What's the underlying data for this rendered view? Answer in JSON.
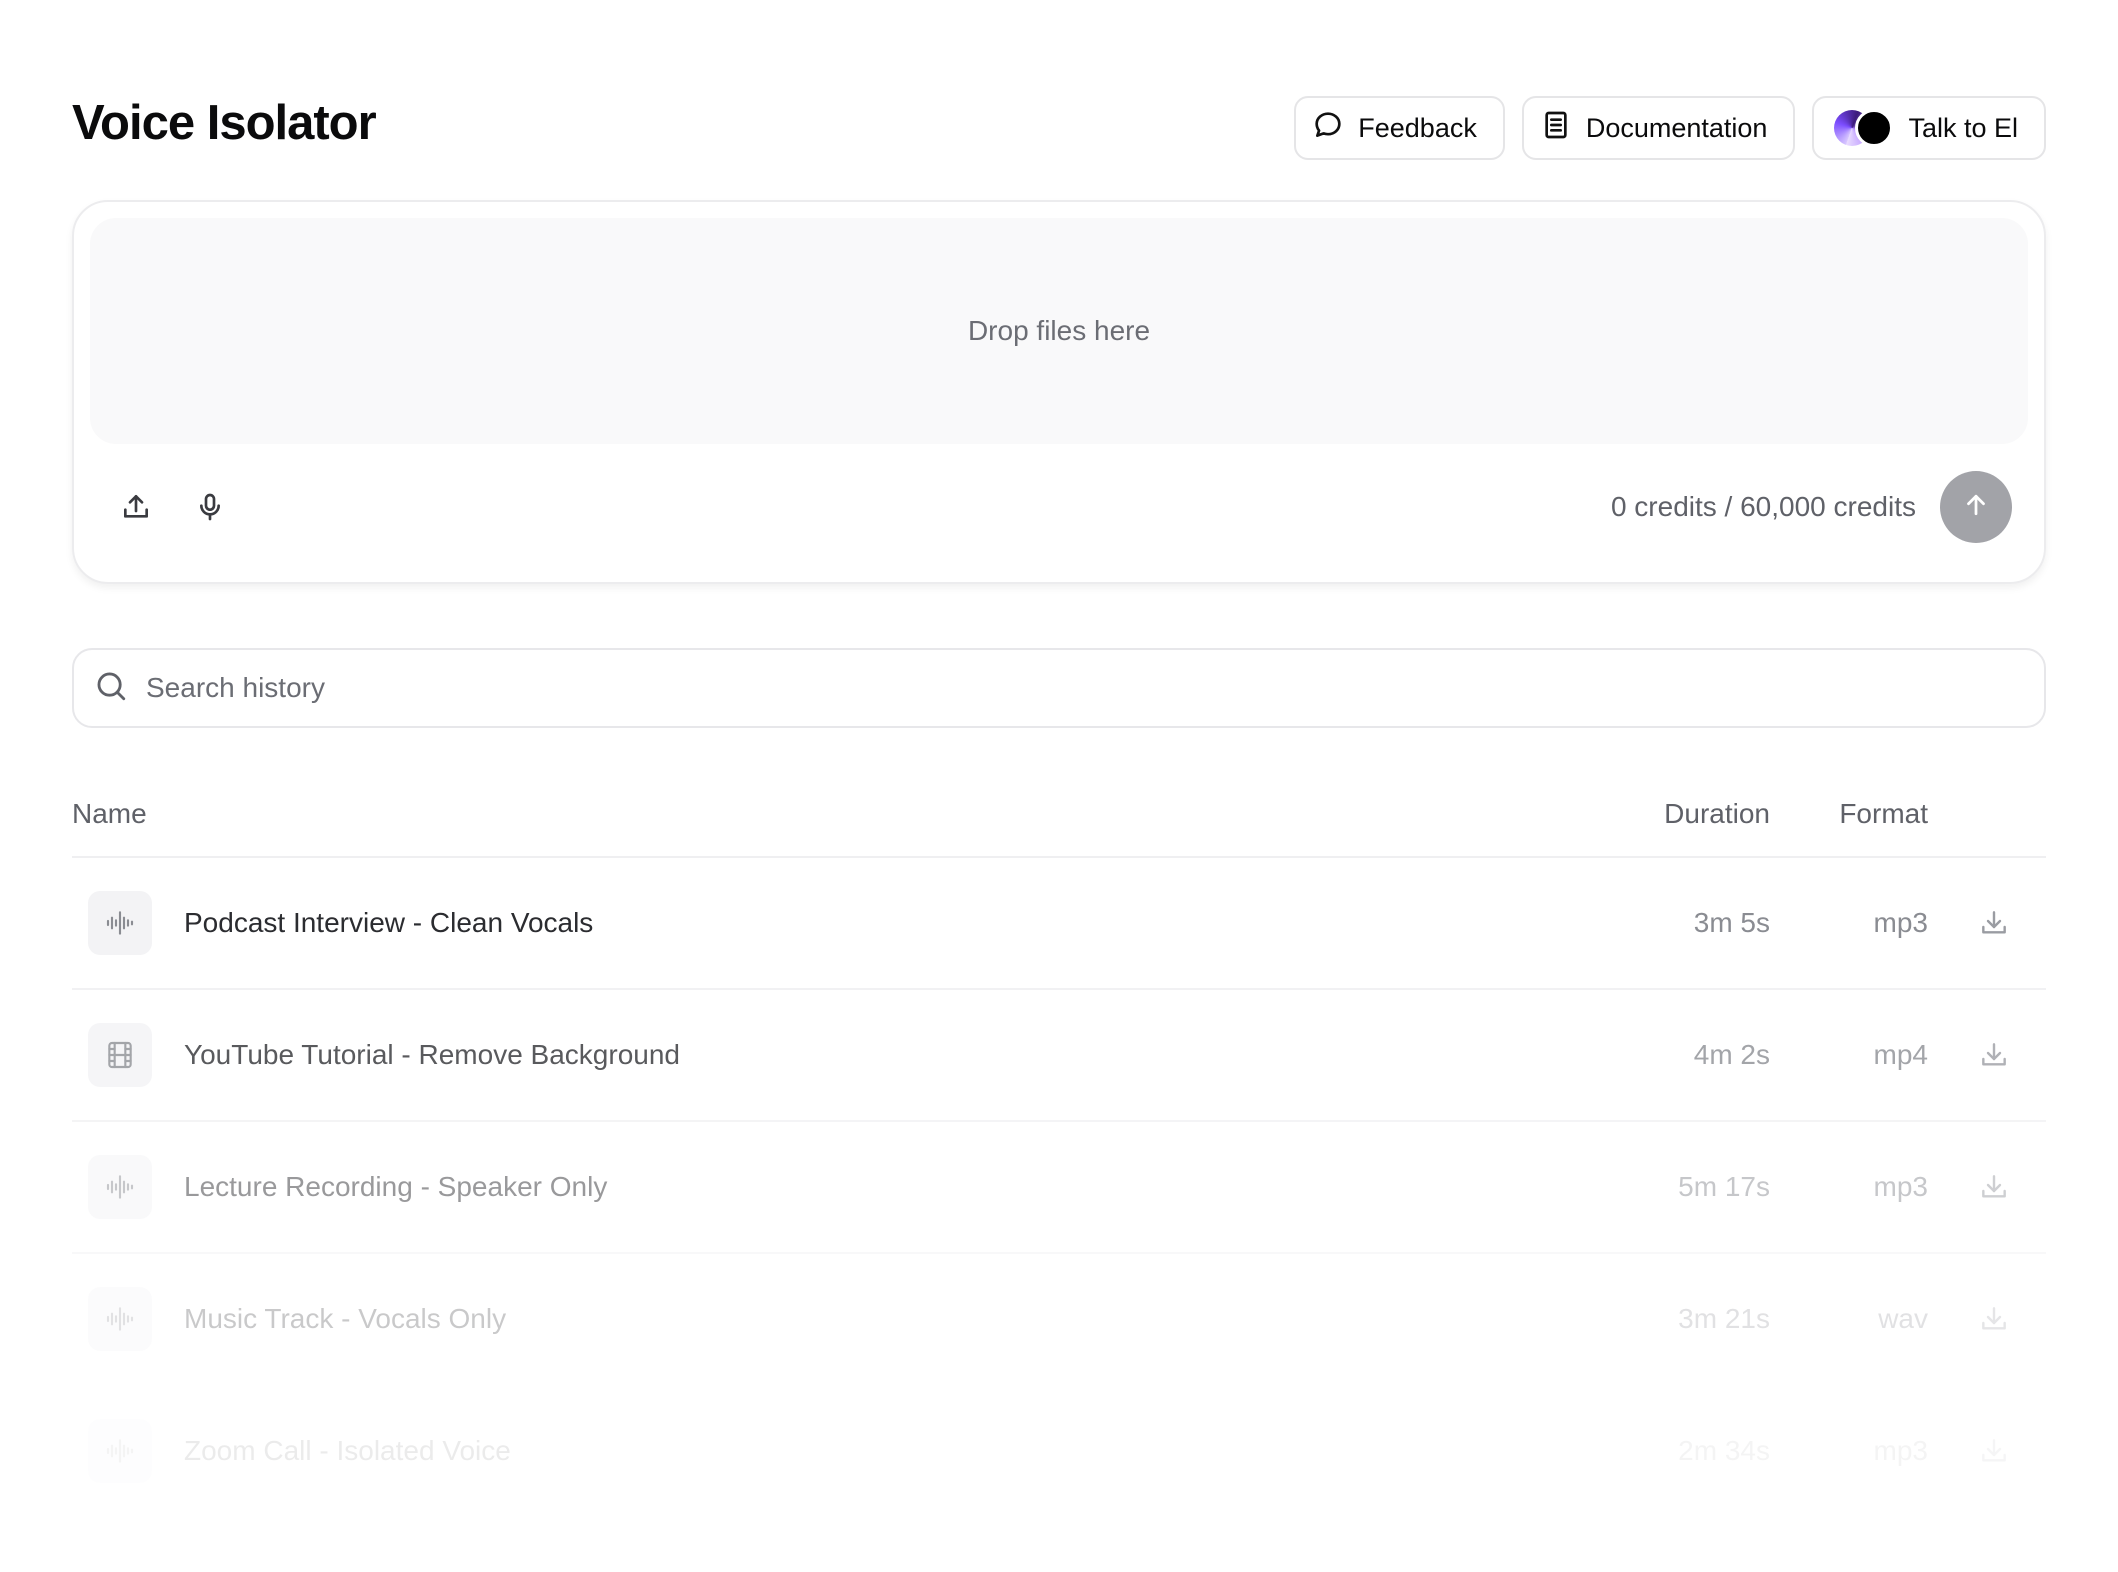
{
  "header": {
    "title": "Voice Isolator",
    "actions": {
      "feedback": "Feedback",
      "documentation": "Documentation",
      "talk": "Talk to El"
    }
  },
  "upload": {
    "dropzone_text": "Drop files here",
    "credits_text": "0 credits / 60,000 credits"
  },
  "search": {
    "placeholder": "Search history",
    "value": ""
  },
  "table": {
    "columns": {
      "name": "Name",
      "duration": "Duration",
      "format": "Format"
    },
    "rows": [
      {
        "name": "Podcast Interview - Clean Vocals",
        "duration": "3m 5s",
        "format": "mp3",
        "icon": "waveform-icon"
      },
      {
        "name": "YouTube Tutorial - Remove Background",
        "duration": "4m 2s",
        "format": "mp4",
        "icon": "video-film-icon"
      },
      {
        "name": "Lecture Recording - Speaker Only",
        "duration": "5m 17s",
        "format": "mp3",
        "icon": "waveform-icon"
      },
      {
        "name": "Music Track - Vocals Only",
        "duration": "3m 21s",
        "format": "wav",
        "icon": "waveform-icon"
      },
      {
        "name": "Zoom Call - Isolated Voice",
        "duration": "2m 34s",
        "format": "mp3",
        "icon": "waveform-icon"
      }
    ]
  },
  "colors": {
    "send_button": "#a2a3a8",
    "dropzone_bg": "#f9f9fa",
    "muted_text": "#6b6d74"
  }
}
